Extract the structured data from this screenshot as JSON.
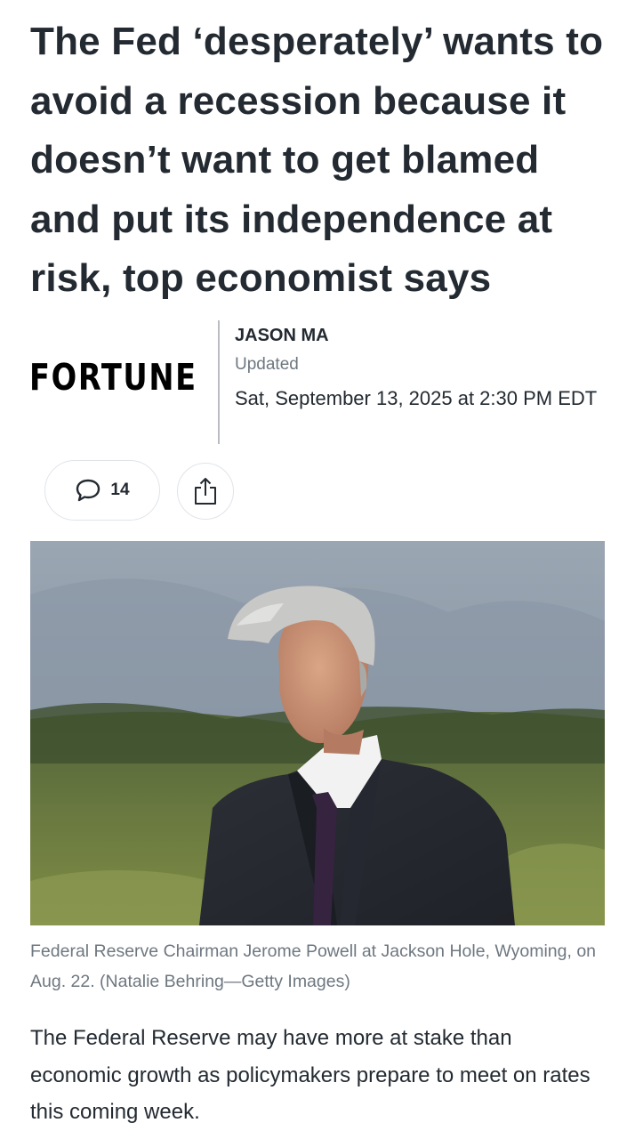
{
  "article": {
    "headline": "The Fed ‘desperately’ wants to avoid a recession because it doesn’t want to get blamed and put its independence at risk, top economist says",
    "publisher": "FORTUNE",
    "author": "JASON MA",
    "updated_label": "Updated",
    "date": "Sat, September 13, 2025 at 2:30 PM EDT",
    "comment_count": "14",
    "image_caption": "Federal Reserve Chairman Jerome Powell at Jackson Hole, Wyoming, on Aug. 22. (Natalie Behring—Getty Images)",
    "body_first_paragraph": "The Federal Reserve may have more at stake than economic growth as policymakers prepare to meet on rates this coming week."
  },
  "icons": {
    "comment": "speech-bubble-icon",
    "share": "share-icon"
  },
  "colors": {
    "text": "#232a31",
    "muted": "#6e7780",
    "border": "#e0e4e9"
  }
}
